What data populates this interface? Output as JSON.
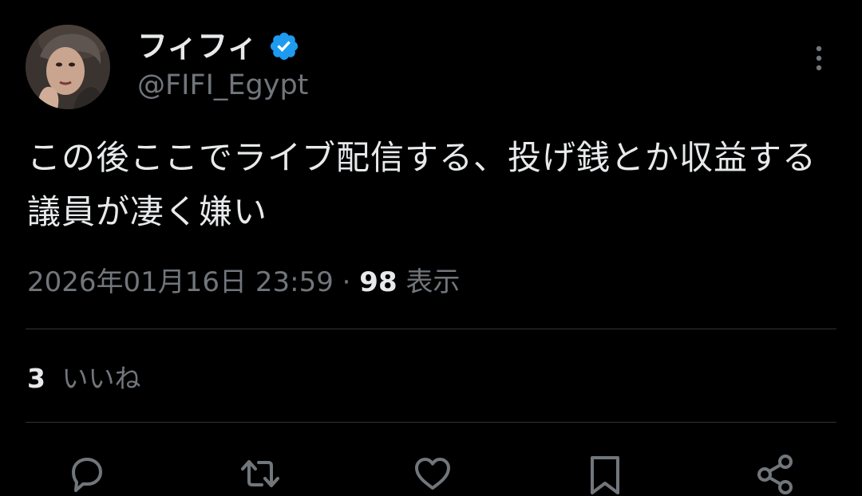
{
  "author": {
    "display_name": "フィフィ",
    "handle": "@FIFI_Egypt",
    "verified": true
  },
  "tweet": {
    "text": "この後ここでライブ配信する、投げ銭とか収益する議員が凄く嫌い",
    "timestamp": "2026年01月16日 23:59",
    "separator": "·",
    "views_count": "98",
    "views_label": "表示",
    "likes_count": "3",
    "likes_label": "いいね"
  },
  "actions": {
    "icons": [
      "reply-icon",
      "retweet-icon",
      "like-icon",
      "bookmark-icon",
      "share-icon"
    ]
  },
  "colors": {
    "background": "#000000",
    "primary_text": "#e7e9ea",
    "secondary_text": "#71767b",
    "divider": "#2f3336",
    "verified_blue": "#1d9bf0"
  }
}
